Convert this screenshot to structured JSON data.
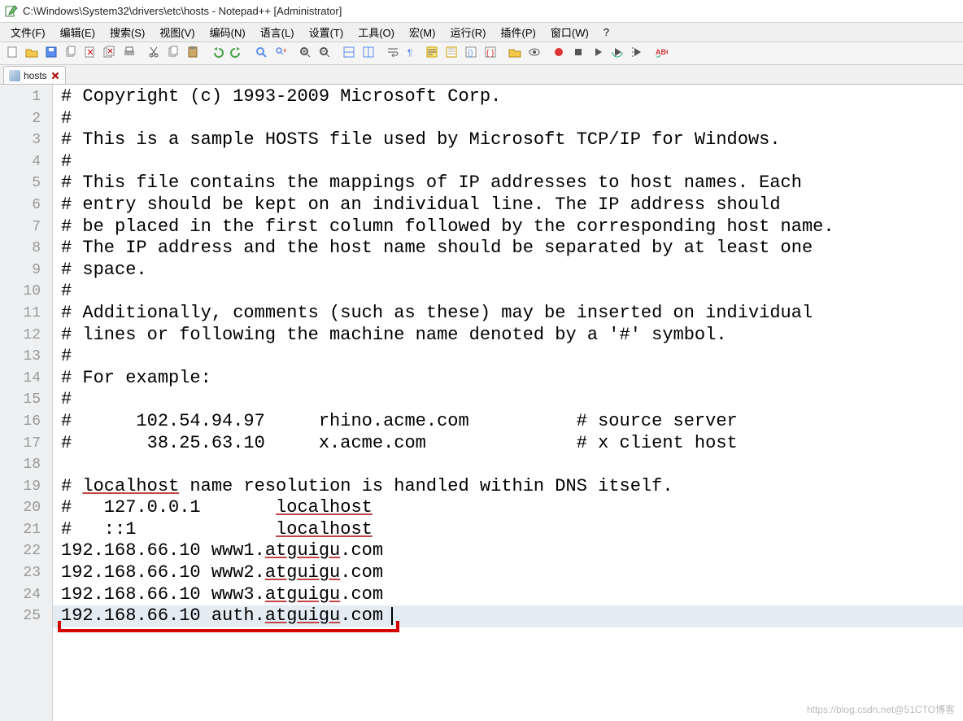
{
  "title": "C:\\Windows\\System32\\drivers\\etc\\hosts - Notepad++ [Administrator]",
  "menu": [
    "文件(F)",
    "编辑(E)",
    "搜索(S)",
    "视图(V)",
    "编码(N)",
    "语言(L)",
    "设置(T)",
    "工具(O)",
    "宏(M)",
    "运行(R)",
    "插件(P)",
    "窗口(W)",
    "?"
  ],
  "tab": {
    "label": "hosts"
  },
  "toolbar_icons": [
    "new",
    "open",
    "save",
    "copy-file",
    "close",
    "close-all",
    "print",
    "cut",
    "copy",
    "paste",
    "undo",
    "redo",
    "find",
    "replace",
    "zoom-in",
    "zoom-out",
    "split-h",
    "split-v",
    "wrap",
    "show-ws",
    "highlight",
    "guide",
    "fold",
    "fold-open",
    "folder",
    "eye",
    "record",
    "stop",
    "play",
    "play-repeat",
    "play-list",
    "spellcheck"
  ],
  "lines": [
    "# Copyright (c) 1993-2009 Microsoft Corp.",
    "#",
    "# This is a sample HOSTS file used by Microsoft TCP/IP for Windows.",
    "#",
    "# This file contains the mappings of IP addresses to host names. Each",
    "# entry should be kept on an individual line. The IP address should",
    "# be placed in the first column followed by the corresponding host name.",
    "# The IP address and the host name should be separated by at least one",
    "# space.",
    "#",
    "# Additionally, comments (such as these) may be inserted on individual",
    "# lines or following the machine name denoted by a '#' symbol.",
    "#",
    "# For example:",
    "#",
    "#      102.54.94.97     rhino.acme.com          # source server",
    "#       38.25.63.10     x.acme.com              # x client host",
    "",
    "# localhost name resolution is handled within DNS itself.",
    "#   127.0.0.1       localhost",
    "#   ::1             localhost",
    "192.168.66.10 www1.atguigu.com",
    "192.168.66.10 www2.atguigu.com",
    "192.168.66.10 www3.atguigu.com",
    "192.168.66.10 auth.atguigu.com"
  ],
  "watermark": "https://blog.csdn.net@51CTO博客"
}
